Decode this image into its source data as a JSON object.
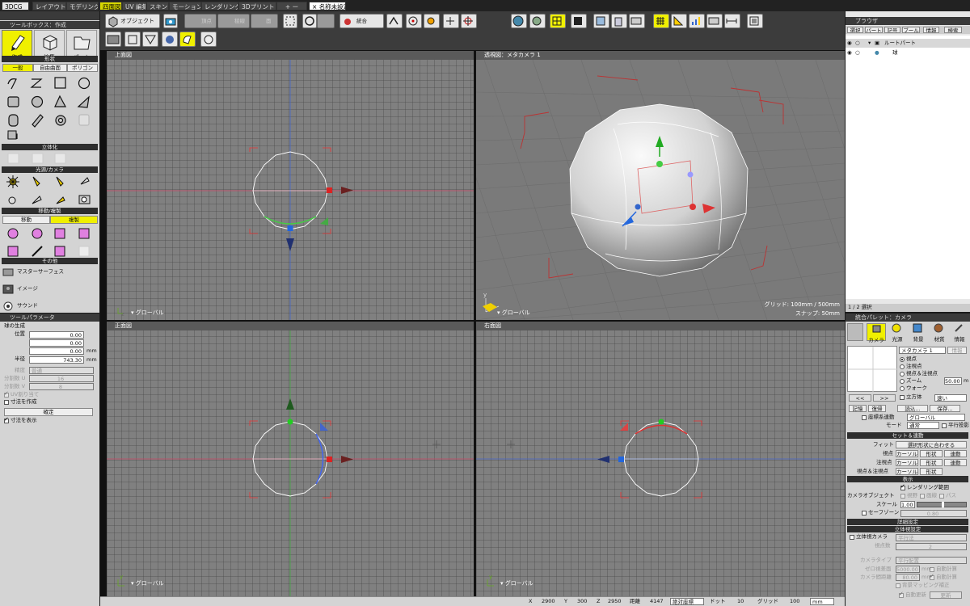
{
  "tabs": [
    "3DCG",
    "レイアウト",
    "モデリング",
    "四面図",
    "UV 編集",
    "スキン",
    "モーション",
    "レンダリング",
    "3Dプリント",
    "+ ー",
    "名称未設定"
  ],
  "toolbox": {
    "title": "ツールボックス：作成",
    "modes": [
      "作成",
      "編集",
      "パート"
    ],
    "sec_shape": "形状",
    "shape_tabs": [
      "一般",
      "自由曲面",
      "ポリゴン"
    ],
    "sec_solid": "立体化",
    "sec_light": "光源/カメラ",
    "sec_move": "移動/複製",
    "move_tabs": [
      "移動",
      "複製"
    ],
    "sec_other": "その他",
    "other_items": [
      "マスターサーフェス",
      "イメージ",
      "サウンド"
    ]
  },
  "params": {
    "title": "ツールパラメータ",
    "group": "球の生成",
    "pos_label": "位置",
    "pos": [
      "0.00",
      "0.00",
      "0.00"
    ],
    "unit": "mm",
    "radius_label": "半径",
    "radius": "743.30",
    "precision_label": "精度",
    "precision": "普通",
    "div_u_label": "分割数 U",
    "div_u": "16",
    "div_v_label": "分割数 V",
    "div_v": "8",
    "uv_label": "UV割り当て",
    "dim_label": "寸法を作成",
    "confirm": "確定",
    "show_dim": "寸法を表示"
  },
  "toolbar": {
    "object_btn": "オブジェクト",
    "vertex": "頂点",
    "edge": "稜線",
    "face": "面",
    "merge": "統合"
  },
  "viewports": {
    "top": "上面図",
    "persp": "透視図：メタカメラ 1",
    "front": "正面図",
    "right": "右面図",
    "global": "グローバル",
    "grid_info": "グリッド: 100mm / 500mm",
    "snap_info": "スナップ: 50mm"
  },
  "browser": {
    "title": "ブラウザ",
    "tabs": [
      "選択",
      "パート",
      "記号",
      "ブール",
      "情報",
      "検索"
    ],
    "root": "ルートパート",
    "child": "球",
    "status": "1 / 2 選択"
  },
  "palette": {
    "title": "統合パレット：カメラ",
    "tabs": [
      "カメラ",
      "光源",
      "背景",
      "材質",
      "情報"
    ],
    "camera_name": "メタカメラ 1",
    "info_btn": "情報",
    "radios": [
      "視点",
      "注視点",
      "視点＆注視点",
      "ズーム",
      "ウォーク"
    ],
    "zoom_val": "50.00",
    "zoom_unit": "m",
    "solid_label": "立方体",
    "speed": "速い",
    "nav": [
      "<<",
      ">>"
    ],
    "store_btns": [
      "記憶",
      "復帰",
      "読込...",
      "保存..."
    ],
    "coord_link": "座標系連動",
    "coord_val": "グローバル",
    "mode_label": "モード",
    "mode_val": "通常",
    "parallel": "平行投影",
    "sec_set": "セット＆連動",
    "fit_label": "フィット",
    "fit_btn": "選択形状に合わせる",
    "rows": [
      {
        "label": "視点",
        "b1": "カーソル",
        "b2": "形状",
        "b3": "連動"
      },
      {
        "label": "注視点",
        "b1": "カーソル",
        "b2": "形状",
        "b3": "連動"
      },
      {
        "label": "視点＆注視点",
        "b1": "カーソル",
        "b2": "形状",
        "b3": ""
      }
    ],
    "sec_disp": "表示",
    "render_range": "レンダリング範囲",
    "cam_obj": "カメラオブジェクト",
    "cam_opts": [
      "視野",
      "画線",
      "パス"
    ],
    "scale_label": "スケール",
    "scale_val": "1.00",
    "safe_zone": "セーフゾーン",
    "safe_val": "0.80",
    "sec_detail": "詳細設定",
    "sec_stereo": "立体視設定",
    "stereo_cam": "立体視カメラ",
    "stereo_val": "平行法",
    "viewpoints_label": "視点数",
    "viewpoints": "2",
    "cam_type_label": "カメラタイプ",
    "cam_type": "平行配置",
    "zero_label": "ゼロ視差面",
    "zero_val": "5000.00",
    "auto_calc": "自動計算",
    "spacing_label": "カメラ間距離",
    "spacing_val": "80.00",
    "auto_calc2": "自動計算",
    "bg_map": "背景マッピング補正",
    "auto_update": "自動更新",
    "update_btn": "更新"
  },
  "status": {
    "x_label": "X",
    "x": "2900",
    "y_label": "Y",
    "y": "300",
    "z_label": "Z",
    "z": "2950",
    "dist_label": "距離",
    "dist": "4147",
    "coord_mode": "絶対座標",
    "dot_label": "ドット",
    "dot": "10",
    "grid_label": "グリッド",
    "grid": "100",
    "unit": "mm"
  },
  "colors": {
    "accent": "#f0f000",
    "viewport": "#808080",
    "panel": "#d4d4d4"
  }
}
